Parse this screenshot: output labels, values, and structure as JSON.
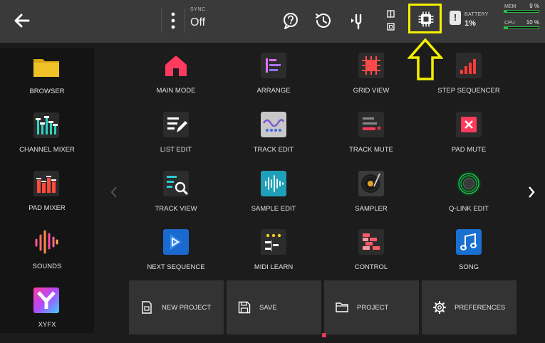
{
  "topbar": {
    "sync_label": "SYNC",
    "sync_value": "Off",
    "battery_label": "BATTERY",
    "battery_value": "1%",
    "mem_label": "MEM",
    "mem_value": "9 %",
    "mem_percent": 9,
    "cpu_label": "CPU",
    "cpu_value": "10 %",
    "cpu_percent": 10,
    "highlight_color": "#f4f000",
    "meter_color": "#2fb84a"
  },
  "sidebar": {
    "items": [
      {
        "label": "BROWSER",
        "icon": "folder-icon"
      },
      {
        "label": "CHANNEL MIXER",
        "icon": "channel-mixer-icon"
      },
      {
        "label": "PAD MIXER",
        "icon": "pad-mixer-icon"
      },
      {
        "label": "SOUNDS",
        "icon": "sounds-icon"
      },
      {
        "label": "XYFX",
        "icon": "xyfx-icon"
      }
    ]
  },
  "modes": {
    "items": [
      {
        "label": "MAIN MODE",
        "icon": "home-icon"
      },
      {
        "label": "ARRANGE",
        "icon": "arrange-icon"
      },
      {
        "label": "GRID VIEW",
        "icon": "grid-view-icon"
      },
      {
        "label": "STEP SEQUENCER",
        "icon": "step-sequencer-icon"
      },
      {
        "label": "LIST EDIT",
        "icon": "list-edit-icon"
      },
      {
        "label": "TRACK EDIT",
        "icon": "track-edit-icon"
      },
      {
        "label": "TRACK MUTE",
        "icon": "track-mute-icon"
      },
      {
        "label": "PAD MUTE",
        "icon": "pad-mute-icon"
      },
      {
        "label": "TRACK VIEW",
        "icon": "track-view-icon"
      },
      {
        "label": "SAMPLE EDIT",
        "icon": "sample-edit-icon"
      },
      {
        "label": "SAMPLER",
        "icon": "sampler-icon"
      },
      {
        "label": "Q-LINK EDIT",
        "icon": "q-link-icon"
      },
      {
        "label": "NEXT SEQUENCE",
        "icon": "next-sequence-icon"
      },
      {
        "label": "MIDI LEARN",
        "icon": "midi-learn-icon"
      },
      {
        "label": "CONTROL",
        "icon": "control-icon"
      },
      {
        "label": "SONG",
        "icon": "song-icon"
      }
    ]
  },
  "bottom": {
    "new_project": "NEW PROJECT",
    "save": "SAVE",
    "project": "PROJECT",
    "preferences": "PREFERENCES"
  }
}
